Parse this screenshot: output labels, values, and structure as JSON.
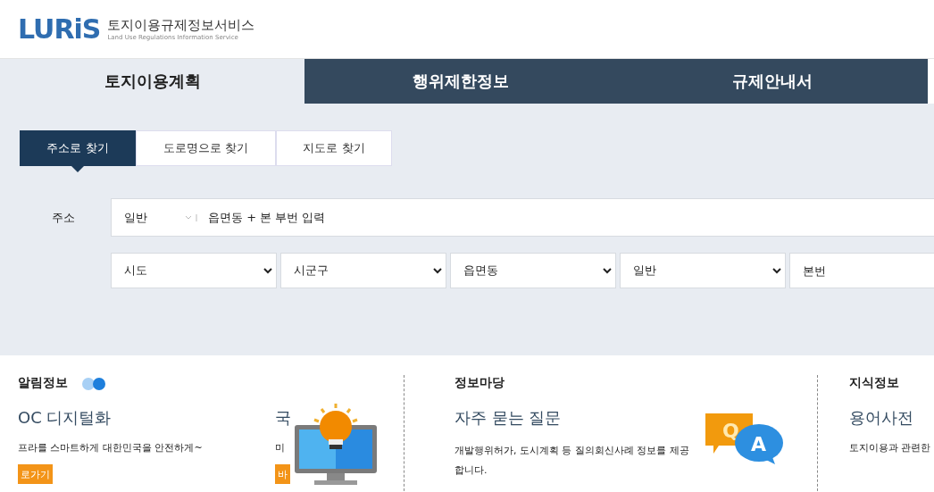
{
  "header": {
    "logo": "LURiS",
    "title": "토지이용규제정보서비스",
    "subtitle": "Land Use Regulations Information Service"
  },
  "tabs": [
    {
      "label": "토지이용계획",
      "selected": true
    },
    {
      "label": "행위제한정보",
      "selected": false
    },
    {
      "label": "규제안내서",
      "selected": false
    }
  ],
  "search_tabs": [
    {
      "label": "주소로 찾기",
      "selected": true
    },
    {
      "label": "도로명으로 찾기",
      "selected": false
    },
    {
      "label": "지도로 찾기",
      "selected": false
    }
  ],
  "address": {
    "label": "주소",
    "type_select": "일반",
    "placeholder": "읍면동 + 본 부번 입력"
  },
  "selects": [
    {
      "kind": "select",
      "value": "시도"
    },
    {
      "kind": "select",
      "value": "시군구"
    },
    {
      "kind": "select",
      "value": "읍면동"
    },
    {
      "kind": "select",
      "value": "일반"
    },
    {
      "kind": "input",
      "placeholder": "본번"
    }
  ],
  "notice": {
    "title": "알림정보",
    "item_title": "OC 디지털화",
    "item_text": "프라를 스마트하게 대한민국을 안전하게~",
    "item_button": "로가기",
    "next_title": "국",
    "next_text": "미",
    "next_button": "바"
  },
  "forum": {
    "title": "정보마당",
    "item_title": "자주 묻는 질문",
    "item_text": "개발행위허가, 도시계획 등 질의회신사례 정보를 제공합니다.",
    "icon_q": "Q",
    "icon_a": "A"
  },
  "knowledge": {
    "title": "지식정보",
    "item_title": "용어사전",
    "item_text": "토지이용과 관련한"
  }
}
